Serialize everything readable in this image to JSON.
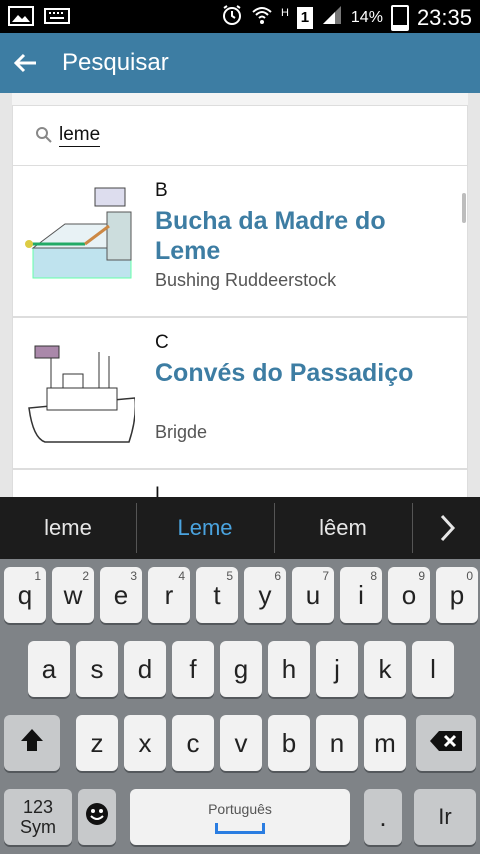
{
  "status_bar": {
    "battery_percent": "14%",
    "time": "23:35",
    "signal_label": "H",
    "sim_label": "1",
    "icons": [
      "image-icon",
      "keyboard-icon",
      "alarm-icon",
      "wifi-icon",
      "sim-icon",
      "signal-icon",
      "battery-icon"
    ]
  },
  "header": {
    "title": "Pesquisar",
    "back_icon": "arrow-left-icon"
  },
  "search": {
    "query": "leme",
    "icon": "search-icon"
  },
  "results": [
    {
      "letter": "B",
      "name": "Bucha da Madre do Leme",
      "subtitle": "Bushing Ruddeerstock"
    },
    {
      "letter": "C",
      "name": "Convés do Passadiço",
      "subtitle": "Brigde"
    },
    {
      "letter": "L",
      "name": "",
      "subtitle": ""
    }
  ],
  "suggestions": [
    "leme",
    "Leme",
    "lêem"
  ],
  "suggestions_selected": "Leme",
  "keyboard": {
    "row1": [
      {
        "label": "q",
        "hint": "1"
      },
      {
        "label": "w",
        "hint": "2"
      },
      {
        "label": "e",
        "hint": "3"
      },
      {
        "label": "r",
        "hint": "4"
      },
      {
        "label": "t",
        "hint": "5"
      },
      {
        "label": "y",
        "hint": "6"
      },
      {
        "label": "u",
        "hint": "7"
      },
      {
        "label": "i",
        "hint": "8"
      },
      {
        "label": "o",
        "hint": "9"
      },
      {
        "label": "p",
        "hint": "0"
      }
    ],
    "row2": [
      "a",
      "s",
      "d",
      "f",
      "g",
      "h",
      "j",
      "k",
      "l"
    ],
    "row3": [
      "z",
      "x",
      "c",
      "v",
      "b",
      "n",
      "m"
    ],
    "sym_label_top": "123",
    "sym_label_bottom": "Sym",
    "language": "Português",
    "period": ".",
    "go_label": "Ir"
  },
  "colors": {
    "accent": "#3d7da3",
    "suggest_active": "#4aa3df"
  }
}
